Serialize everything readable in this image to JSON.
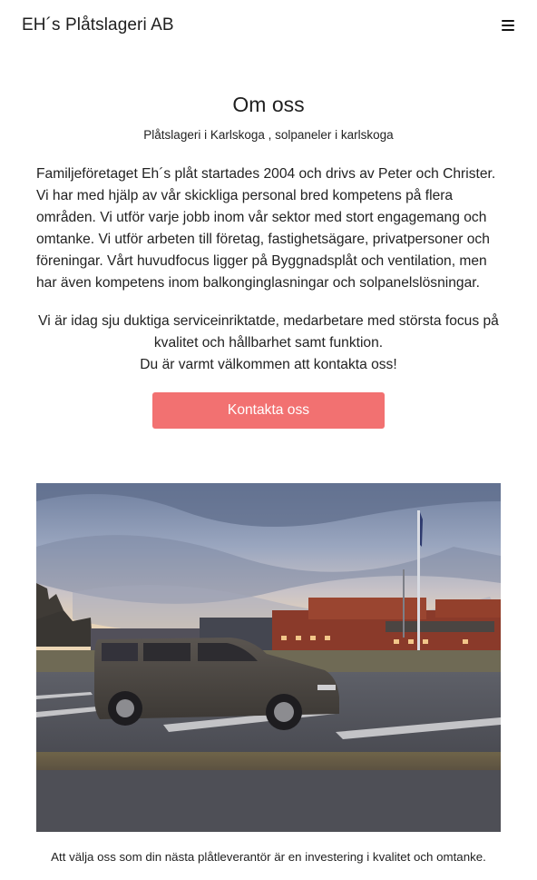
{
  "header": {
    "brand": "EH´s Plåtslageri AB",
    "menu_icon": "hamburger-menu-icon"
  },
  "about": {
    "title": "Om oss",
    "subtitle": "Plåtslageri i Karlskoga , solpaneler i karlskoga",
    "intro": "Familjeföretaget Eh´s plåt startades 2004 och drivs av Peter och Christer. Vi har med hjälp av vår skickliga personal bred kompetens på flera områden. Vi utför varje jobb inom vår sektor med stort engagemang och omtanke. Vi utför arbeten till företag, fastighetsägare, privatpersoner och föreningar. Vårt huvudfocus ligger på Byggnadsplåt och ventilation, men har även kompetens inom balkonginglasningar och solpanelslösningar.",
    "statement_line1": "Vi är idag sju duktiga serviceinriktatde, medarbetare med största focus på kvalitet och hållbarhet samt funktion.",
    "statement_line2": "Du är varmt välkommen att kontakta oss!",
    "cta_label": "Kontakta oss"
  },
  "photo": {
    "caption": "Att välja oss som din nästa plåtleverantör är en investering i kvalitet och omtanke."
  },
  "colors": {
    "cta_background": "#f27171",
    "text": "#212121",
    "background": "#ffffff"
  }
}
